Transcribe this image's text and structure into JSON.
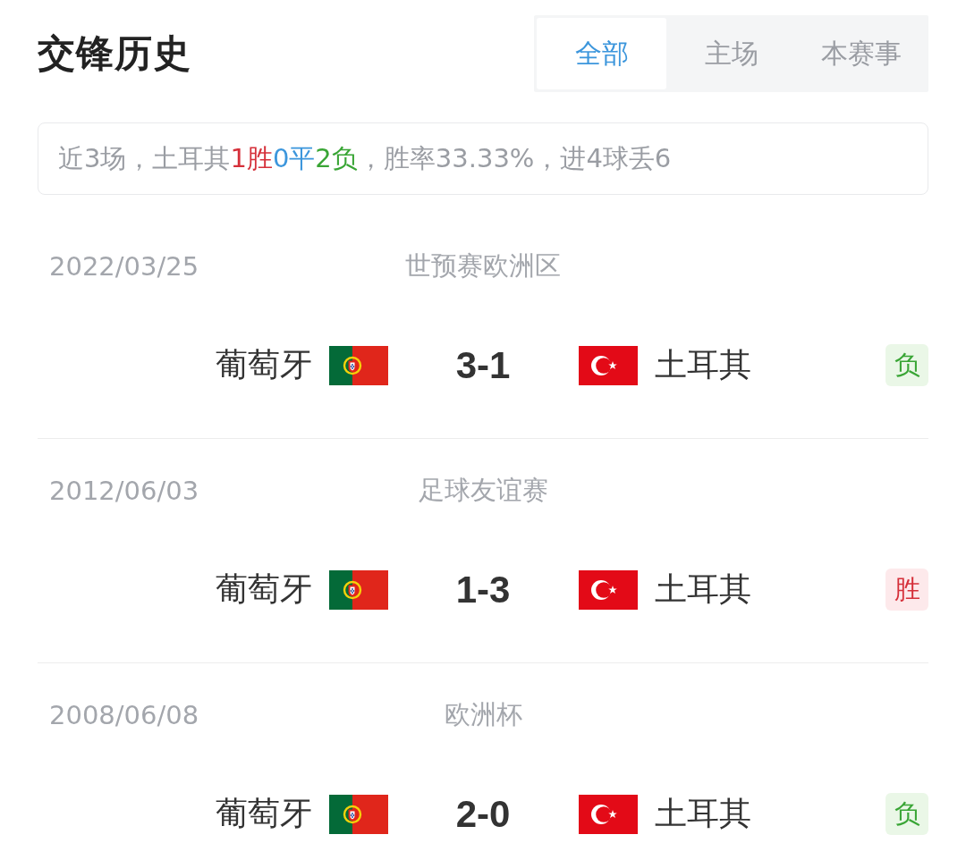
{
  "header": {
    "title": "交锋历史",
    "tabs": [
      {
        "label": "全部",
        "selected": true
      },
      {
        "label": "主场",
        "selected": false
      },
      {
        "label": "本赛事",
        "selected": false
      }
    ]
  },
  "summary": {
    "segments": [
      {
        "text": "近3场，土耳其",
        "kind": "plain"
      },
      {
        "text": "1胜",
        "kind": "win"
      },
      {
        "text": "0平",
        "kind": "draw"
      },
      {
        "text": "2负",
        "kind": "loss"
      },
      {
        "text": "，胜率33.33%，进4球丢6",
        "kind": "plain"
      }
    ]
  },
  "matches": [
    {
      "date": "2022/03/25",
      "competition": "世预赛欧洲区",
      "home": {
        "name": "葡萄牙",
        "kind": "portugal"
      },
      "score": "3-1",
      "away": {
        "name": "土耳其",
        "kind": "turkey"
      },
      "result": {
        "text": "负",
        "kind": "loss"
      }
    },
    {
      "date": "2012/06/03",
      "competition": "足球友谊赛",
      "home": {
        "name": "葡萄牙",
        "kind": "portugal"
      },
      "score": "1-3",
      "away": {
        "name": "土耳其",
        "kind": "turkey"
      },
      "result": {
        "text": "胜",
        "kind": "win"
      }
    },
    {
      "date": "2008/06/08",
      "competition": "欧洲杯",
      "home": {
        "name": "葡萄牙",
        "kind": "portugal"
      },
      "score": "2-0",
      "away": {
        "name": "土耳其",
        "kind": "turkey"
      },
      "result": {
        "text": "负",
        "kind": "loss"
      }
    }
  ]
}
